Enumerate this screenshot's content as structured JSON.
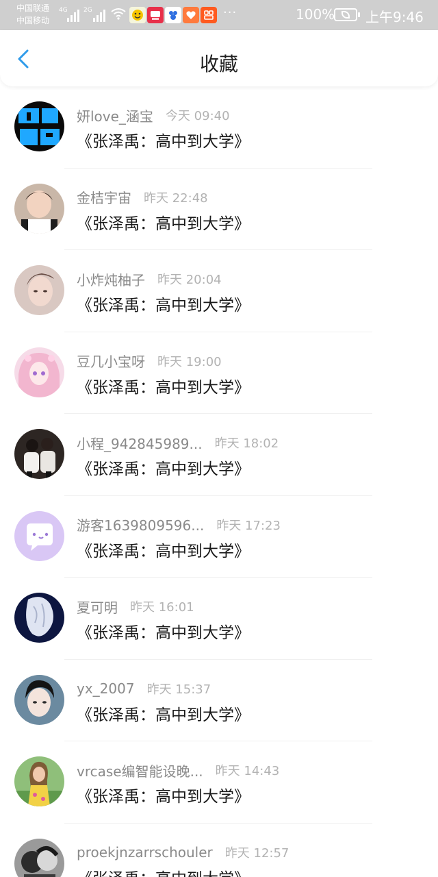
{
  "status_bar": {
    "carrier_1": "中国联通",
    "carrier_2": "中国移动",
    "net_1": "4G",
    "net_2": "2G",
    "dots": "···",
    "battery": "100%",
    "time": "上午9:46"
  },
  "nav": {
    "back_icon": "chevron-left-icon",
    "title": "收藏"
  },
  "colors": {
    "accent": "#2f9bea",
    "status_bar_bg": "#cfcfcf",
    "username": "#8a8a8a",
    "time": "#b3b3b3"
  },
  "items": [
    {
      "user": "妍love_涵宝",
      "time": "今天 09:40",
      "title": "《张泽禹：高中到大学》"
    },
    {
      "user": "金桔宇宙",
      "time": "昨天 22:48",
      "title": "《张泽禹：高中到大学》"
    },
    {
      "user": "小炸炖柚子",
      "time": "昨天 20:04",
      "title": "《张泽禹：高中到大学》"
    },
    {
      "user": "豆几小宝呀",
      "time": "昨天 19:00",
      "title": "《张泽禹：高中到大学》"
    },
    {
      "user": "小程_942845989...",
      "time": "昨天 18:02",
      "title": "《张泽禹：高中到大学》"
    },
    {
      "user": "游客1639809596...",
      "time": "昨天 17:23",
      "title": "《张泽禹：高中到大学》"
    },
    {
      "user": "夏可明",
      "time": "昨天 16:01",
      "title": "《张泽禹：高中到大学》"
    },
    {
      "user": "yx_2007",
      "time": "昨天 15:37",
      "title": "《张泽禹：高中到大学》"
    },
    {
      "user": "vrcase编智能设晚...",
      "time": "昨天 14:43",
      "title": "《张泽禹：高中到大学》"
    },
    {
      "user": "proekjnzarrschouler",
      "time": "昨天 12:57",
      "title": "《张泽禹：高中到大学》"
    }
  ]
}
